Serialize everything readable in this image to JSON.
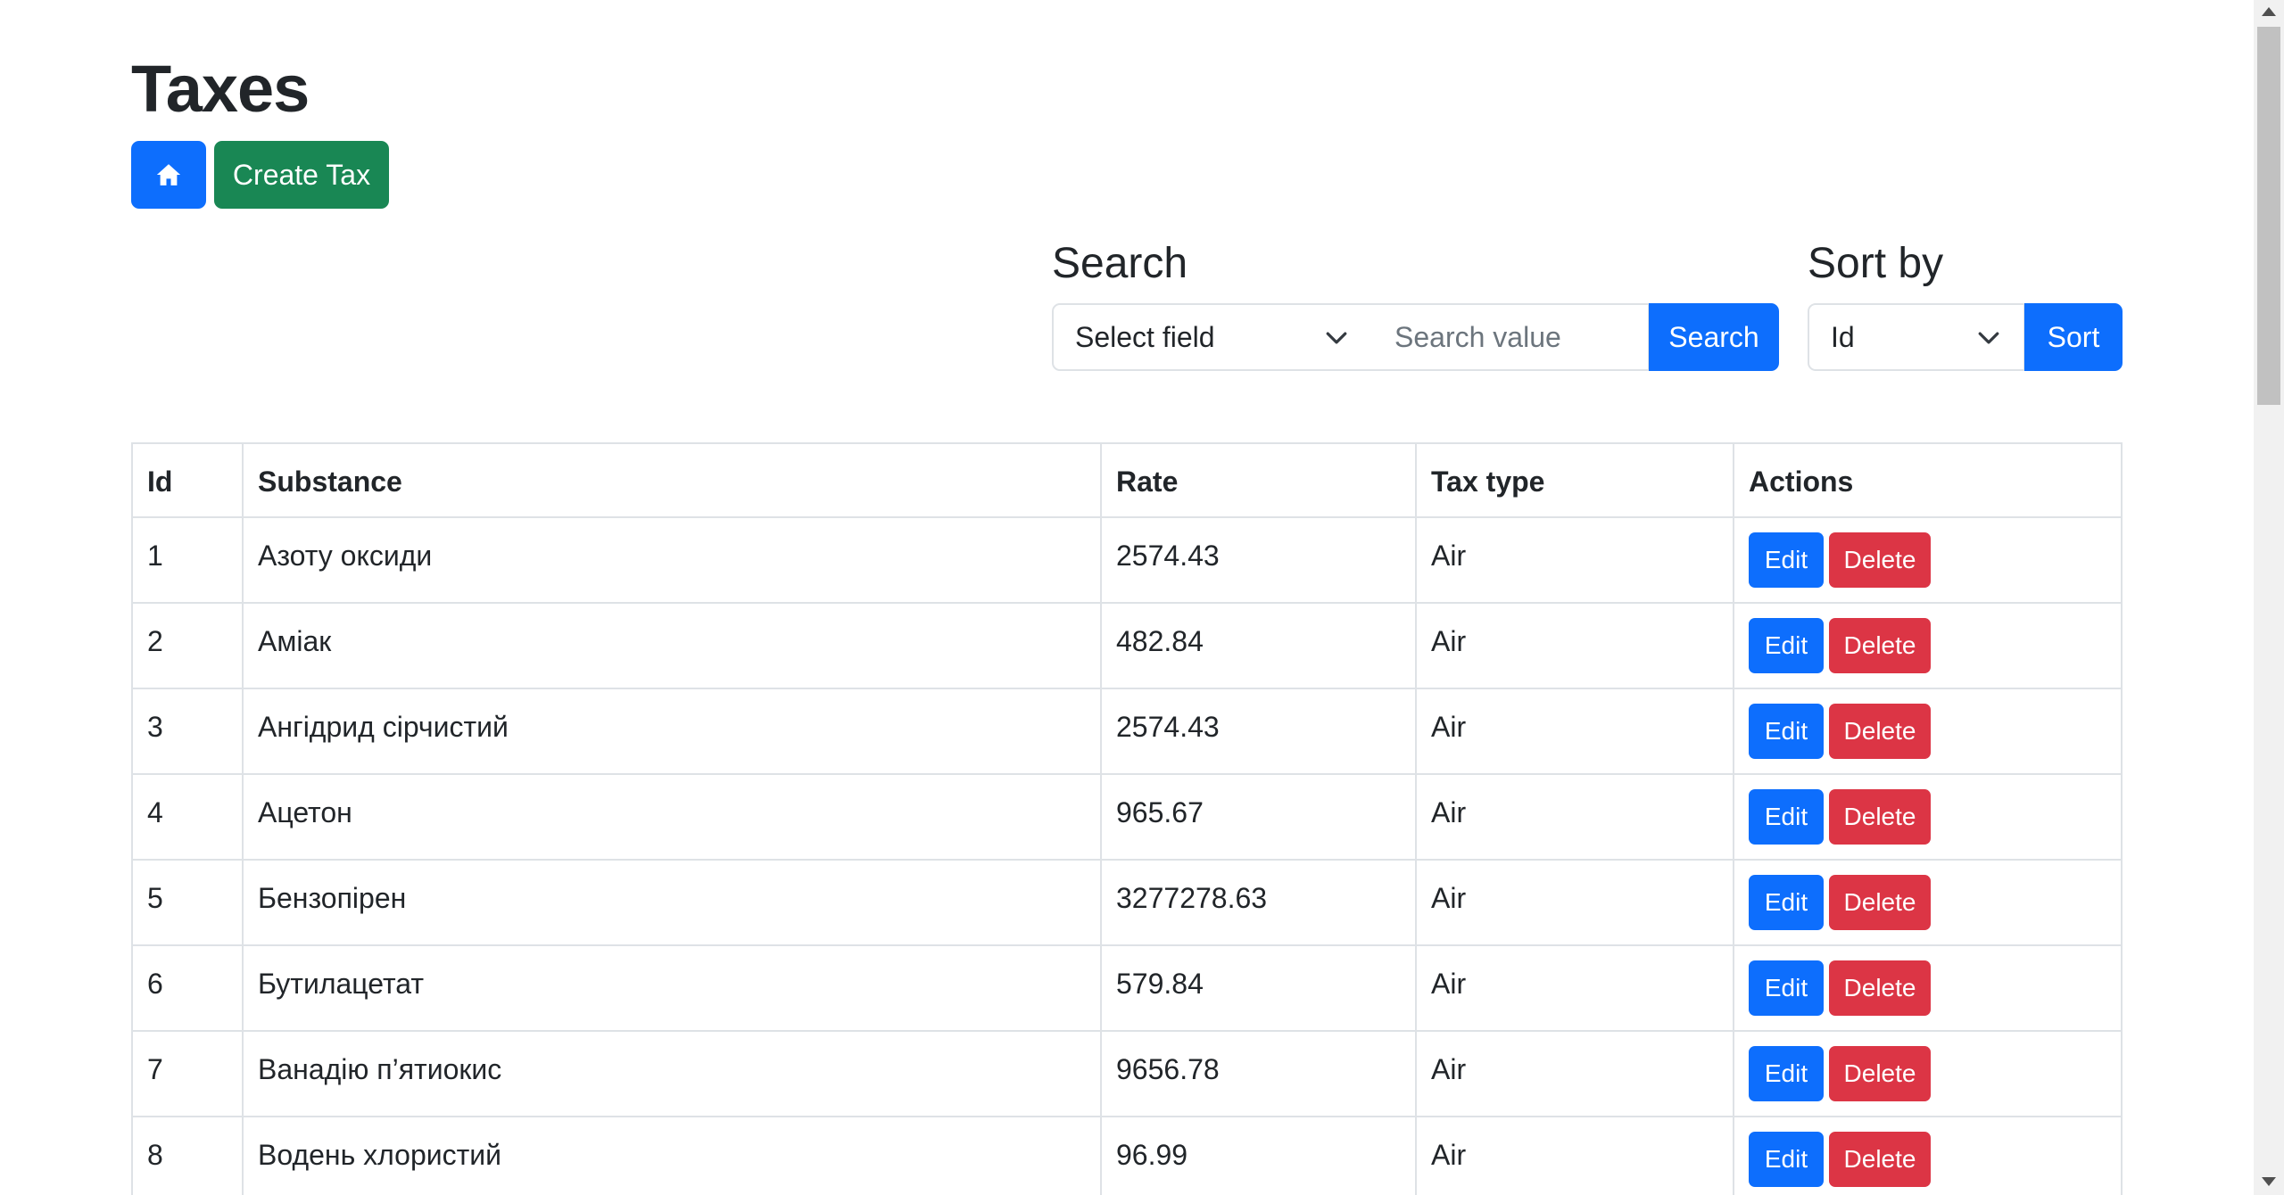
{
  "page": {
    "title": "Taxes",
    "home_icon": "home-icon",
    "create_label": "Create Tax"
  },
  "search": {
    "label": "Search",
    "field_select_value": "Select field",
    "placeholder": "Search value",
    "button_label": "Search"
  },
  "sort": {
    "label": "Sort by",
    "select_value": "Id",
    "button_label": "Sort"
  },
  "table": {
    "headers": [
      "Id",
      "Substance",
      "Rate",
      "Tax type",
      "Actions"
    ],
    "edit_label": "Edit",
    "delete_label": "Delete",
    "rows": [
      {
        "id": "1",
        "substance": "Азоту оксиди",
        "rate": "2574.43",
        "type": "Air"
      },
      {
        "id": "2",
        "substance": "Аміак",
        "rate": "482.84",
        "type": "Air"
      },
      {
        "id": "3",
        "substance": "Ангідрид сірчистий",
        "rate": "2574.43",
        "type": "Air"
      },
      {
        "id": "4",
        "substance": "Ацетон",
        "rate": "965.67",
        "type": "Air"
      },
      {
        "id": "5",
        "substance": "Бензопірен",
        "rate": "3277278.63",
        "type": "Air"
      },
      {
        "id": "6",
        "substance": "Бутилацетат",
        "rate": "579.84",
        "type": "Air"
      },
      {
        "id": "7",
        "substance": "Ванадію п’ятиокис",
        "rate": "9656.78",
        "type": "Air"
      },
      {
        "id": "8",
        "substance": "Водень хлористий",
        "rate": "96.99",
        "type": "Air"
      }
    ]
  },
  "colors": {
    "primary": "#0d6efd",
    "success": "#198754",
    "danger": "#dc3545",
    "border": "#dee2e6"
  }
}
